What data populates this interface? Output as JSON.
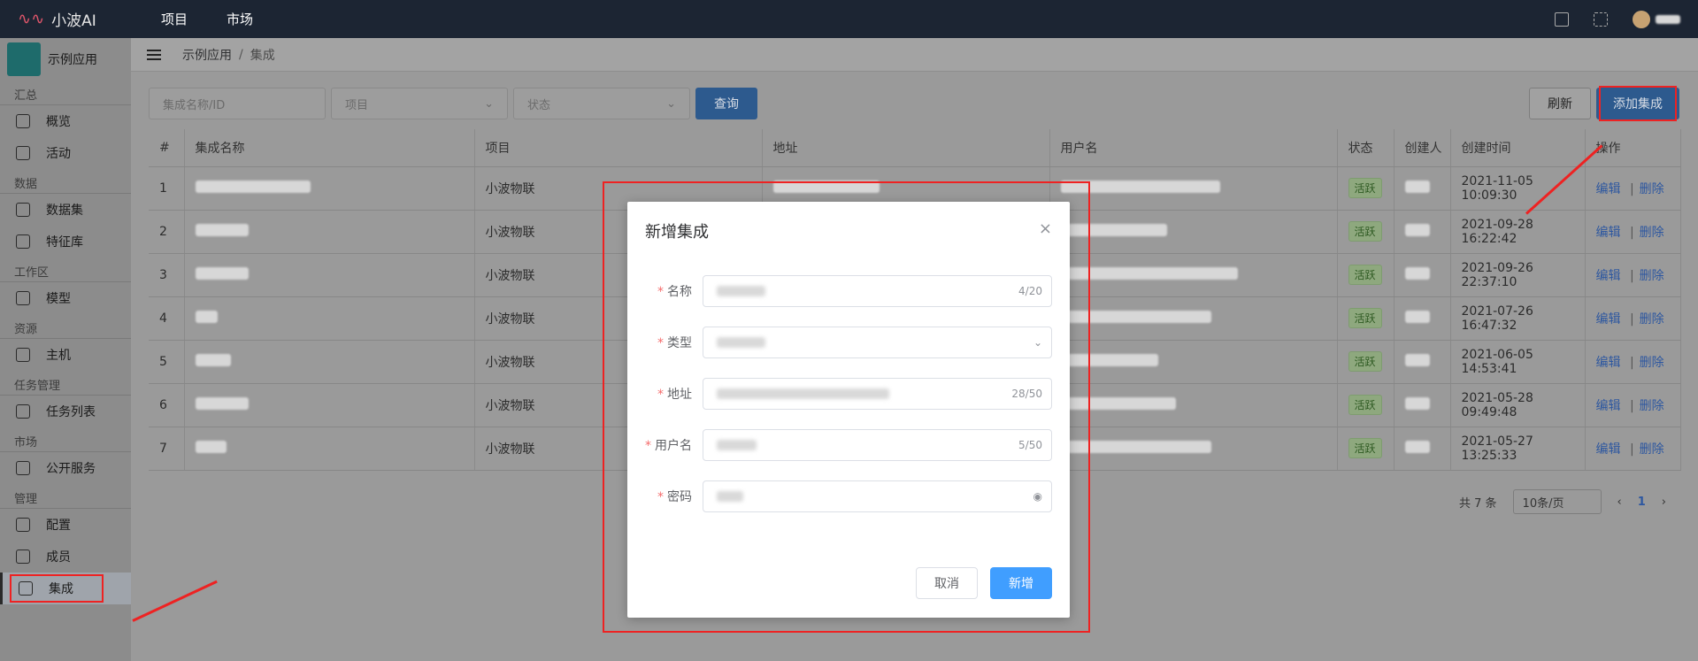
{
  "topbar": {
    "brand": "小波AI",
    "nav": [
      "项目",
      "市场"
    ]
  },
  "sidebar": {
    "app_name": "示例应用",
    "groups": [
      {
        "title": "汇总",
        "items": [
          "概览",
          "活动"
        ]
      },
      {
        "title": "数据",
        "items": [
          "数据集",
          "特征库"
        ]
      },
      {
        "title": "工作区",
        "items": [
          "模型"
        ]
      },
      {
        "title": "资源",
        "items": [
          "主机"
        ]
      },
      {
        "title": "任务管理",
        "items": [
          "任务列表"
        ]
      },
      {
        "title": "市场",
        "items": [
          "公开服务"
        ]
      },
      {
        "title": "管理",
        "items": [
          "配置",
          "成员",
          "集成"
        ]
      }
    ]
  },
  "breadcrumb": {
    "root": "示例应用",
    "separator": "/",
    "current": "集成"
  },
  "filters": {
    "name_placeholder": "集成名称/ID",
    "project_placeholder": "项目",
    "status_placeholder": "状态",
    "query_label": "查询",
    "refresh_label": "刷新",
    "add_label": "添加集成"
  },
  "table": {
    "headers": [
      "#",
      "集成名称",
      "项目",
      "地址",
      "用户名",
      "状态",
      "创建人",
      "创建时间",
      "操作"
    ],
    "rows": [
      {
        "num": "1",
        "project": "小波物联",
        "status": "活跃",
        "created": "2021-11-05 10:09:30"
      },
      {
        "num": "2",
        "project": "小波物联",
        "status": "活跃",
        "created": "2021-09-28 16:22:42"
      },
      {
        "num": "3",
        "project": "小波物联",
        "status": "活跃",
        "created": "2021-09-26 22:37:10"
      },
      {
        "num": "4",
        "project": "小波物联",
        "status": "活跃",
        "created": "2021-07-26 16:47:32"
      },
      {
        "num": "5",
        "project": "小波物联",
        "status": "活跃",
        "created": "2021-06-05 14:53:41"
      },
      {
        "num": "6",
        "project": "小波物联",
        "status": "活跃",
        "created": "2021-05-28 09:49:48"
      },
      {
        "num": "7",
        "project": "小波物联",
        "status": "活跃",
        "created": "2021-05-27 13:25:33"
      }
    ],
    "edit_label": "编辑",
    "delete_label": "删除",
    "action_separator": "|"
  },
  "pager": {
    "total": "共 7 条",
    "page_size": "10条/页",
    "current_page": "1"
  },
  "dialog": {
    "title": "新增集成",
    "close": "×",
    "fields": [
      {
        "label": "名称",
        "count": "4/20"
      },
      {
        "label": "类型",
        "count": ""
      },
      {
        "label": "地址",
        "count": "28/50"
      },
      {
        "label": "用户名",
        "count": "5/50"
      },
      {
        "label": "密码",
        "count": ""
      }
    ],
    "required_mark": "*",
    "cancel_label": "取消",
    "ok_label": "新增"
  },
  "colors": {
    "accent": "#409eff",
    "danger": "#ee2222",
    "topbar": "#1c2533"
  }
}
